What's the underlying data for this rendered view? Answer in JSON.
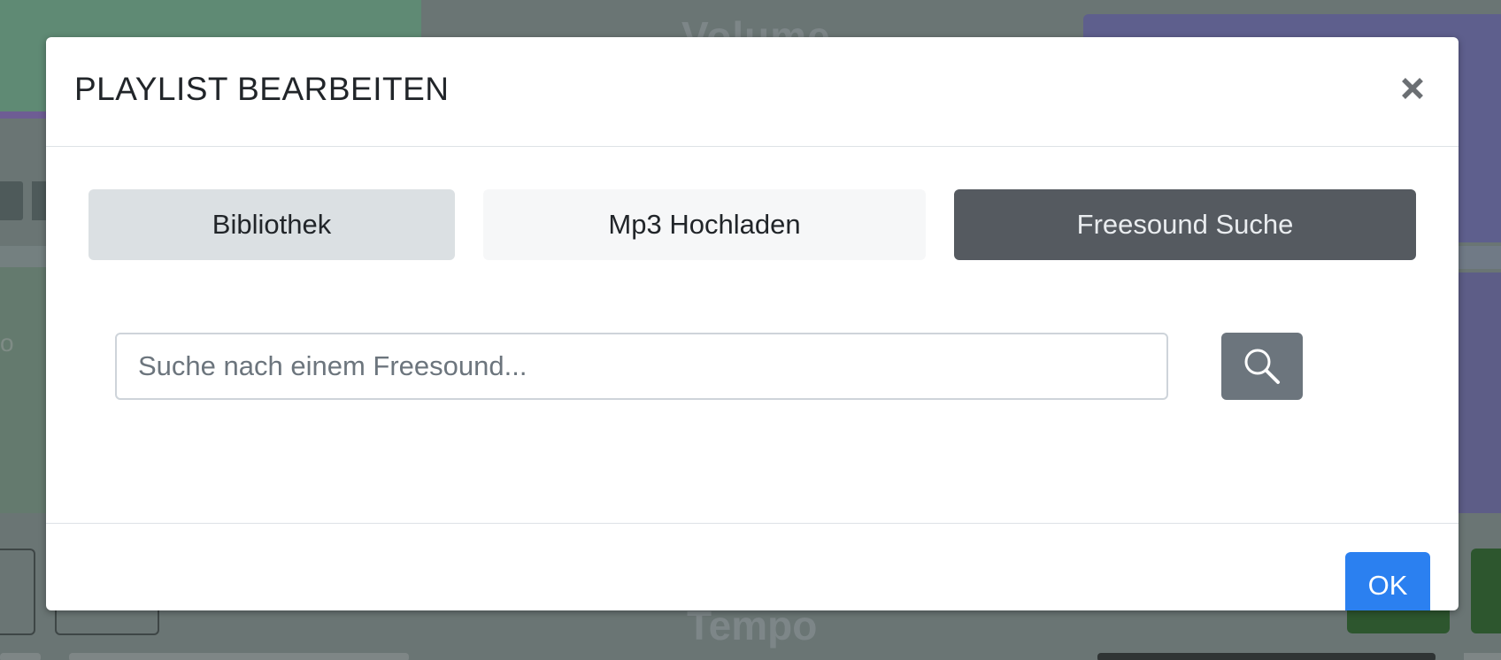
{
  "background": {
    "volume_label": "Volume",
    "tempo_label": "Tempo",
    "partial_glyph": "o"
  },
  "modal": {
    "title": "PLAYLIST BEARBEITEN",
    "close_icon": "close-icon",
    "tabs": [
      {
        "label": "Bibliothek",
        "state": "active-light"
      },
      {
        "label": "Mp3 Hochladen",
        "state": "inactive"
      },
      {
        "label": "Freesound Suche",
        "state": "selected"
      }
    ],
    "search": {
      "placeholder": "Suche nach einem Freesound...",
      "value": "",
      "button_icon": "search-icon"
    },
    "ok_label": "OK"
  },
  "colors": {
    "primary": "#2b80f0",
    "secondary": "#6c757d",
    "dark": "#555a60",
    "overlay": "#6a7574"
  }
}
